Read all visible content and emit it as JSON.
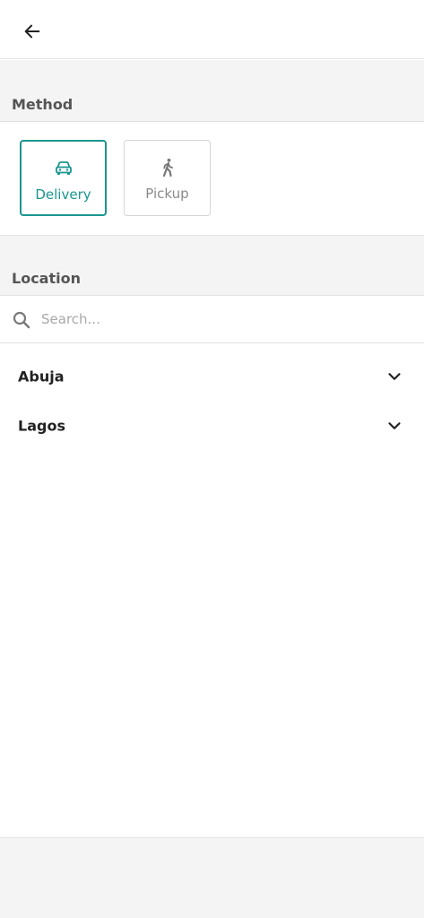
{
  "topbar": {
    "back_icon": "arrow-left-icon"
  },
  "method": {
    "title": "Method",
    "options": [
      {
        "label": "Delivery",
        "icon": "car-icon",
        "selected": true
      },
      {
        "label": "Pickup",
        "icon": "walking-person-icon",
        "selected": false
      }
    ]
  },
  "location": {
    "title": "Location",
    "search": {
      "placeholder": "Search...",
      "value": "",
      "icon": "search-icon"
    },
    "items": [
      {
        "label": "Abuja",
        "icon": "chevron-down-icon"
      },
      {
        "label": "Lagos",
        "icon": "chevron-down-icon"
      }
    ]
  },
  "colors": {
    "accent": "#1a9690",
    "section_bg": "#f4f4f4",
    "muted": "#8a8a8a"
  }
}
